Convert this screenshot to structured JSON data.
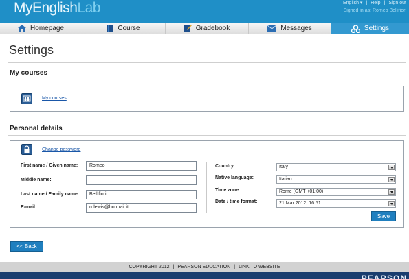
{
  "header": {
    "logo_my": "My",
    "logo_english": "English",
    "logo_lab": "Lab",
    "language": "English",
    "language_caret": "▾",
    "separator": "|",
    "help": "Help",
    "signout": "Sign out",
    "signed_in": "Signed in as: Romeo Bellifiori"
  },
  "nav": {
    "items": [
      {
        "label": "Homepage",
        "icon": "home-icon"
      },
      {
        "label": "Course",
        "icon": "book-icon"
      },
      {
        "label": "Gradebook",
        "icon": "gradebook-icon"
      },
      {
        "label": "Messages",
        "icon": "envelope-icon"
      },
      {
        "label": "Settings",
        "icon": "gears-icon"
      }
    ],
    "active": "Settings"
  },
  "page": {
    "title": "Settings"
  },
  "my_courses": {
    "heading": "My courses",
    "link": "My courses"
  },
  "personal": {
    "heading": "Personal details",
    "change_password": "Change password",
    "fields": {
      "first_name": {
        "label": "First name / Given name:",
        "value": "Romeo"
      },
      "middle_name": {
        "label": "Middle name:",
        "value": ""
      },
      "last_name": {
        "label": "Last name / Family name:",
        "value": "Bellifiori"
      },
      "email": {
        "label": "E-mail:",
        "value": "rulewis@hotmail.it"
      }
    },
    "selects": {
      "country": {
        "label": "Country:",
        "value": "Italy"
      },
      "language": {
        "label": "Native language:",
        "value": "Italian"
      },
      "timezone": {
        "label": "Time zone:",
        "value": "Rome (GMT +01:00)"
      },
      "format": {
        "label": "Date / time format:",
        "value": "21 Mar 2012, 16:51"
      }
    },
    "save": "Save"
  },
  "back": "<< Back",
  "footer": {
    "copyright": "COPYRIGHT 2012",
    "sep": "|",
    "company": "PEARSON EDUCATION",
    "link": "LINK TO WEBSITE"
  },
  "brand": "PEARSON",
  "colors": {
    "topbar": "#1f8fc7",
    "active_tab": "#3399d0",
    "button": "#1f7fbf",
    "bottombar": "#1a3d6e"
  }
}
